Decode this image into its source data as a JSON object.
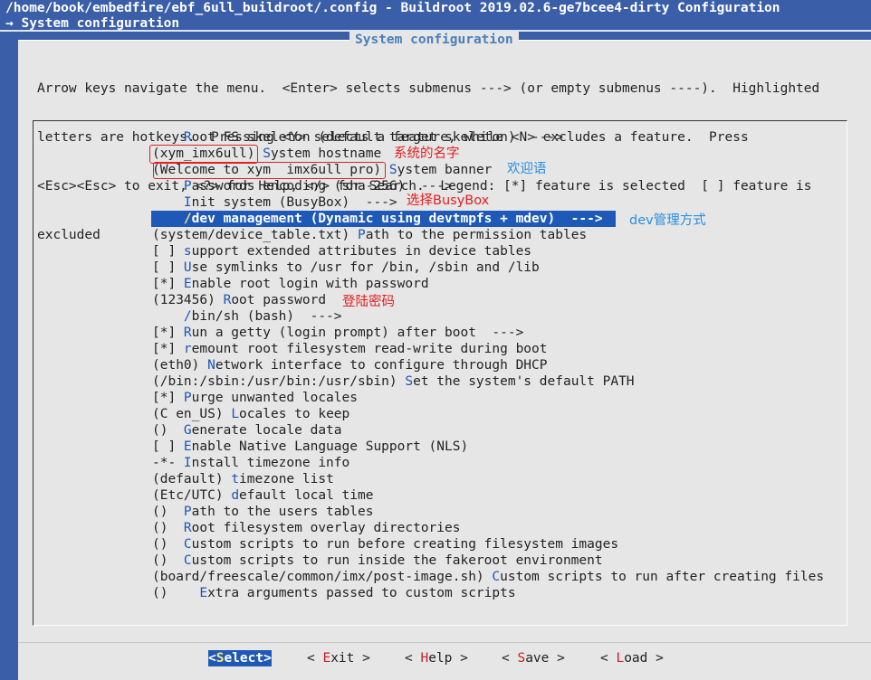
{
  "header": {
    "path_title": "/home/book/embedfire/ebf_6ull_buildroot/.config - Buildroot 2019.02.6-ge7bcee4-dirty Configuration",
    "breadcrumb": "→ System configuration"
  },
  "dialog": {
    "title": "System configuration",
    "help_lines": [
      "Arrow keys navigate the menu.  <Enter> selects submenus ---> (or empty submenus ----).  Highlighted",
      "letters are hotkeys.  Pressing <Y> selects a feature, while <N> excludes a feature.  Press",
      "<Esc><Esc> to exit, <?> for Help, </> for Search.  Legend: [*] feature is selected  [ ] feature is",
      "excluded"
    ]
  },
  "menu": {
    "items": [
      {
        "prefix": "    ",
        "hot": "R",
        "rest": "oot FS skeleton (default target skeleton)  --->"
      },
      {
        "prefix": "(xym_imx6ull) ",
        "hot": "S",
        "rest": "ystem hostname"
      },
      {
        "prefix": "(Welcome to xym  imx6ull pro) ",
        "hot": "S",
        "rest": "ystem banner"
      },
      {
        "prefix": "    ",
        "hot": "P",
        "rest": "asswords encoding (sha-256)  --->"
      },
      {
        "prefix": "    ",
        "hot": "I",
        "rest": "nit system (BusyBox)  --->"
      },
      {
        "prefix": "    ",
        "hot": "/",
        "rest": "dev management (Dynamic using devtmpfs + mdev)  --->"
      },
      {
        "prefix": "(system/device_table.txt) ",
        "hot": "P",
        "rest": "ath to the permission tables"
      },
      {
        "prefix": "[ ] ",
        "hot": "s",
        "rest": "upport extended attributes in device tables"
      },
      {
        "prefix": "[ ] ",
        "hot": "U",
        "rest": "se symlinks to /usr for /bin, /sbin and /lib"
      },
      {
        "prefix": "[*] ",
        "hot": "E",
        "rest": "nable root login with password"
      },
      {
        "prefix": "(123456) ",
        "hot": "R",
        "rest": "oot password"
      },
      {
        "prefix": "    ",
        "hot": "/",
        "rest": "bin/sh (bash)  --->"
      },
      {
        "prefix": "[*] ",
        "hot": "R",
        "rest": "un a getty (login prompt) after boot  --->"
      },
      {
        "prefix": "[*] ",
        "hot": "r",
        "rest": "emount root filesystem read-write during boot"
      },
      {
        "prefix": "(eth0) ",
        "hot": "N",
        "rest": "etwork interface to configure through DHCP"
      },
      {
        "prefix": "(/bin:/sbin:/usr/bin:/usr/sbin) ",
        "hot": "S",
        "rest": "et the system's default PATH"
      },
      {
        "prefix": "[*] ",
        "hot": "P",
        "rest": "urge unwanted locales"
      },
      {
        "prefix": "(C en_US) ",
        "hot": "L",
        "rest": "ocales to keep"
      },
      {
        "prefix": "()  ",
        "hot": "G",
        "rest": "enerate locale data"
      },
      {
        "prefix": "[ ] ",
        "hot": "E",
        "rest": "nable Native Language Support (NLS)"
      },
      {
        "prefix": "-*- ",
        "hot": "I",
        "rest": "nstall timezone info"
      },
      {
        "prefix": "(default) ",
        "hot": "t",
        "rest": "imezone list"
      },
      {
        "prefix": "(Etc/UTC) ",
        "hot": "d",
        "rest": "efault local time"
      },
      {
        "prefix": "()  ",
        "hot": "P",
        "rest": "ath to the users tables"
      },
      {
        "prefix": "()  ",
        "hot": "R",
        "rest": "oot filesystem overlay directories"
      },
      {
        "prefix": "()  ",
        "hot": "C",
        "rest": "ustom scripts to run before creating filesystem images"
      },
      {
        "prefix": "()  ",
        "hot": "C",
        "rest": "ustom scripts to run inside the fakeroot environment"
      },
      {
        "prefix": "(board/freescale/common/imx/post-image.sh) ",
        "hot": "C",
        "rest": "ustom scripts to run after creating files"
      },
      {
        "prefix": "()    ",
        "hot": "E",
        "rest": "xtra arguments passed to custom scripts"
      }
    ],
    "selected_index": 5
  },
  "annotations": {
    "hostname": "系统的名字",
    "banner": "欢迎语",
    "init": "选择BusyBox",
    "dev": "dev管理方式",
    "password": "登陆密码"
  },
  "buttons": [
    {
      "open": "<",
      "key": "S",
      "rest": "elect",
      "close": ">",
      "selected": true
    },
    {
      "open": "< ",
      "key": "E",
      "rest": "xit",
      "close": " >",
      "selected": false
    },
    {
      "open": "< ",
      "key": "H",
      "rest": "elp",
      "close": " >",
      "selected": false
    },
    {
      "open": "< ",
      "key": "S",
      "rest": "ave",
      "close": " >",
      "selected": false
    },
    {
      "open": "< ",
      "key": "L",
      "rest": "oad",
      "close": " >",
      "selected": false
    }
  ],
  "colors": {
    "background": "#3a5ea8",
    "dialog": "#e6e6e6",
    "highlight": "#1f59b8",
    "hotkey": "#1d55b5",
    "annotation_red": "#e02020",
    "annotation_blue": "#2a8ee0"
  }
}
